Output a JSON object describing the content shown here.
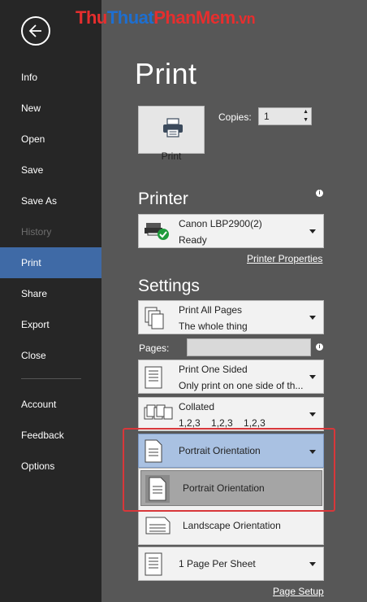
{
  "watermark": {
    "part1": "Thu",
    "part2": "Thuat",
    "part3": "PhanMem",
    "part4": ".vn"
  },
  "sidebar": {
    "items": [
      {
        "label": "Info"
      },
      {
        "label": "New"
      },
      {
        "label": "Open"
      },
      {
        "label": "Save"
      },
      {
        "label": "Save As"
      },
      {
        "label": "History"
      },
      {
        "label": "Print"
      },
      {
        "label": "Share"
      },
      {
        "label": "Export"
      },
      {
        "label": "Close"
      },
      {
        "label": "Account"
      },
      {
        "label": "Feedback"
      },
      {
        "label": "Options"
      }
    ]
  },
  "main": {
    "title": "Print"
  },
  "print_button": {
    "label": "Print"
  },
  "copies": {
    "label": "Copies:",
    "value": "1"
  },
  "printer": {
    "section_title": "Printer",
    "name": "Canon LBP2900(2)",
    "status": "Ready",
    "properties_link": "Printer Properties"
  },
  "settings": {
    "section_title": "Settings",
    "print_range": {
      "line1": "Print All Pages",
      "line2": "The whole thing"
    },
    "pages_label": "Pages:",
    "pages_value": "",
    "sides": {
      "line1": "Print One Sided",
      "line2": "Only print on one side of th..."
    },
    "collation": {
      "line1": "Collated",
      "line2": "1,2,3    1,2,3    1,2,3"
    },
    "orientation": {
      "selected": "Portrait Orientation"
    },
    "orientation_options": [
      "Portrait Orientation",
      "Landscape Orientation"
    ],
    "pages_per_sheet": {
      "line1": "1 Page Per Sheet"
    },
    "page_setup_link": "Page Setup"
  },
  "colors": {
    "sidebar_bg": "#262626",
    "selected_nav": "#3f6aa6",
    "main_bg": "#575757",
    "highlight_border": "#d8373a"
  }
}
